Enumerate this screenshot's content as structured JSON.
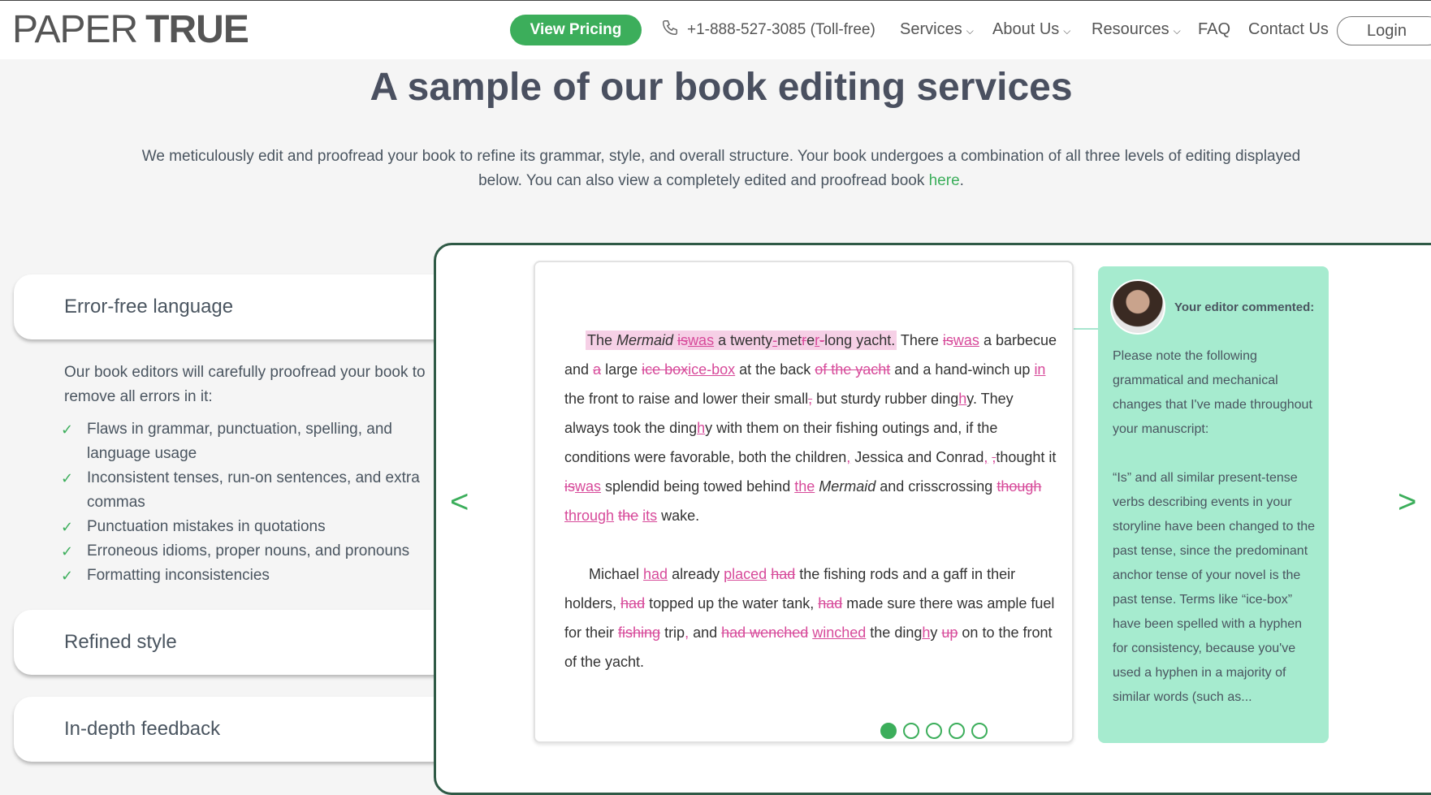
{
  "header": {
    "logo_part1": "PAPER",
    "logo_part2": "TRUE",
    "pricing_label": "View Pricing",
    "phone": "+1-888-527-3085 (Toll-free)",
    "nav": [
      {
        "label": "Services"
      },
      {
        "label": "About Us"
      },
      {
        "label": "Resources"
      },
      {
        "label": "FAQ"
      },
      {
        "label": "Contact Us"
      }
    ],
    "login_label": "Login"
  },
  "hero": {
    "title": "A sample of our book editing services",
    "intro_line": "We meticulously edit and proofread your book to refine its grammar, style, and overall structure. Your book undergoes a combination of all three levels of editing displayed below. You can also view a completely edited and proofread book ",
    "intro_link": "here",
    "intro_end": "."
  },
  "accordion": {
    "items": [
      {
        "label": "Error-free language"
      },
      {
        "label": "Refined style"
      },
      {
        "label": "In-depth feedback"
      }
    ],
    "body_intro": "Our book editors will carefully proofread your book to remove all errors in it:",
    "checklist": [
      "Flaws in grammar, punctuation, spelling, and language usage",
      "Inconsistent tenses, run-on sentences, and extra commas",
      "Punctuation mistakes in quotations",
      "Erroneous idioms, proper nouns, and pronouns",
      "Formatting inconsistencies"
    ]
  },
  "sample": {
    "prev_arrow": "<",
    "next_arrow": ">",
    "dots_total": 5,
    "dots_active": 1
  },
  "comment": {
    "header": "Your editor commented:",
    "para1": "Please note the following grammatical and mechanical changes that I've made throughout your manuscript:",
    "para2": "“Is” and all similar present-tense verbs describing events in your storyline have been changed to the past tense, since the predominant anchor tense of your novel is the past tense. Terms like “ice-box” have been spelled with a hyphen for consistency, because you've used a hyphen in a majority of similar words (such as..."
  },
  "colors": {
    "brand_green": "#3cae5b",
    "edit_pink": "#d74a9a",
    "comment_bg": "#a6ebcf",
    "panel_border": "#2f5a46"
  }
}
